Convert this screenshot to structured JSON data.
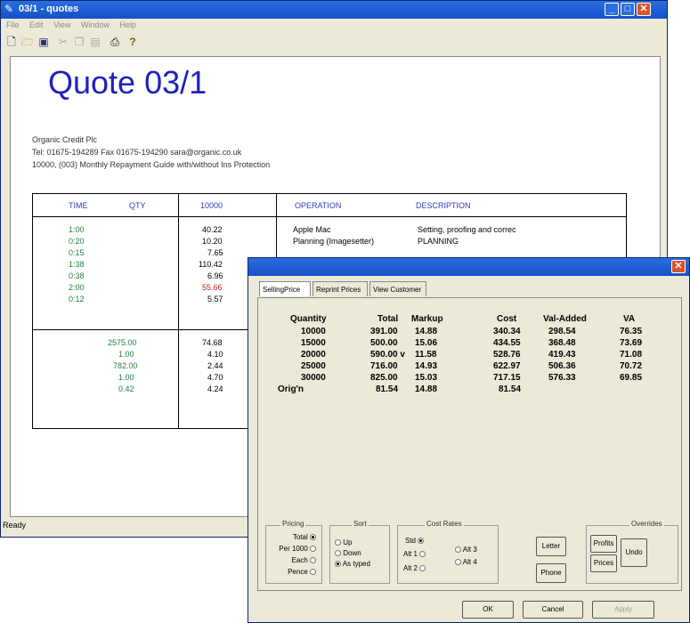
{
  "main_window": {
    "title": "03/1 - quotes",
    "menu": [
      "File",
      "Edit",
      "View",
      "Window",
      "Help"
    ],
    "toolbar_icons": [
      "new-icon",
      "open-icon",
      "save-icon",
      "cut-icon",
      "copy-icon",
      "paste-icon",
      "print-icon",
      "help-icon"
    ],
    "status": "Ready"
  },
  "document": {
    "title": "Quote 03/1",
    "company": "Organic Credit Plc",
    "contact": "Tel: 01675-194289 Fax 01675-194290 sara@organic.co.uk",
    "job": "10000, (003) Monthly Repayment Guide with/without Ins Protection",
    "table": {
      "headers": {
        "time": "TIME",
        "qty": "QTY",
        "col3": "10000",
        "operation": "OPERATION",
        "description": "DESCRIPTION"
      },
      "times": [
        "1:00",
        "0:20",
        "0:15",
        "1:38",
        "0:38",
        "2:00",
        "0:12"
      ],
      "values": [
        "40.22",
        "10.20",
        "7.65",
        "110.42",
        "6.96",
        "55.66",
        "5.57"
      ],
      "operations": [
        "Apple Mac",
        "Planning (Imagesetter)"
      ],
      "descriptions": [
        "Setting, proofing and correc",
        "PLANNING"
      ],
      "qtys": [
        "2575.00",
        "1.00",
        "782.00",
        "1.00",
        "0.42"
      ],
      "values2": [
        "74.68",
        "4.10",
        "2.44",
        "4.70",
        "4.24"
      ]
    }
  },
  "dialog": {
    "tabs": [
      "SellingPrice",
      "Reprint Prices",
      "View Customer"
    ],
    "columns": [
      "Quantity",
      "Total",
      "Markup",
      "Cost",
      "Val-Added",
      "VA"
    ],
    "rows": [
      [
        "10000",
        "391.00",
        "14.88",
        "340.34",
        "298.54",
        "76.35"
      ],
      [
        "15000",
        "500.00",
        "15.06",
        "434.55",
        "368.48",
        "73.69"
      ],
      [
        "20000",
        "590.00 v",
        "11.58",
        "528.76",
        "419.43",
        "71.08"
      ],
      [
        "25000",
        "716.00",
        "14.93",
        "622.97",
        "506.36",
        "70.72"
      ],
      [
        "30000",
        "825.00",
        "15.03",
        "717.15",
        "576.33",
        "69.85"
      ],
      [
        "Orig'n",
        "81.54",
        "14.88",
        "81.54",
        "",
        ""
      ]
    ],
    "pricing": {
      "title": "Pricing",
      "options": [
        "Total",
        "Per 1000",
        "Each",
        "Pence"
      ],
      "selected": "Total"
    },
    "sort": {
      "title": "Sort",
      "options": [
        "Up",
        "Down",
        "As typed"
      ],
      "selected": "As typed"
    },
    "cost_rates": {
      "title": "Cost Rates",
      "options": [
        "Std",
        "Alt 1",
        "Alt 2",
        "Alt 3",
        "Alt 4"
      ],
      "selected": "Std"
    },
    "letter_label": "Letter",
    "phone_label": "Phone",
    "overrides": {
      "title": "Overrides",
      "profits": "Profits",
      "prices": "Prices",
      "undo": "Undo"
    },
    "ok_label": "OK",
    "cancel_label": "Cancel",
    "apply_label": "Apply"
  }
}
